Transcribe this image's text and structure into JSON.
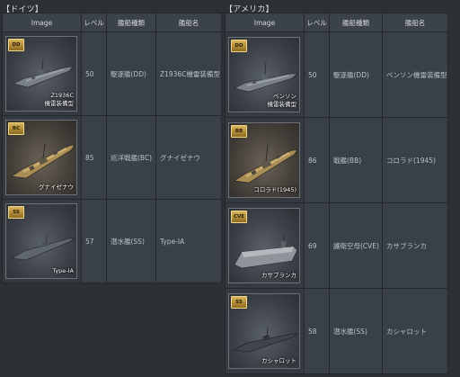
{
  "germany": {
    "title": "【ドイツ】",
    "headers": {
      "image": "Image",
      "level": "レベル",
      "type": "艦船種類",
      "name": "艦船名"
    },
    "rows": [
      {
        "badge": "DD",
        "caption1": "Z1936C",
        "caption2": "機雷装備型",
        "level": "50",
        "type": "駆逐艦(DD)",
        "name": "Z1936C機雷装備型",
        "icon": "destroyer-icon"
      },
      {
        "badge": "BC",
        "caption1": "グナイゼナウ",
        "caption2": "",
        "level": "85",
        "type": "巡洋戦艦(BC)",
        "name": "グナイゼナウ",
        "icon": "battlecruiser-icon"
      },
      {
        "badge": "SS",
        "caption1": "Type-IA",
        "caption2": "",
        "level": "57",
        "type": "潜水艦(SS)",
        "name": "Type-IA",
        "icon": "submarine-icon"
      }
    ]
  },
  "usa": {
    "title": "【アメリカ】",
    "headers": {
      "image": "Image",
      "level": "レベル",
      "type": "艦船種類",
      "name": "艦船名"
    },
    "rows": [
      {
        "badge": "DD",
        "caption1": "ベンソン",
        "caption2": "機雷装備型",
        "level": "50",
        "type": "駆逐艦(DD)",
        "name": "ベンソン機雷装備型",
        "icon": "destroyer-icon"
      },
      {
        "badge": "BB",
        "caption1": "コロラド(1945)",
        "caption2": "",
        "level": "86",
        "type": "戦艦(BB)",
        "name": "コロラド(1945)",
        "icon": "battleship-icon"
      },
      {
        "badge": "CVE",
        "caption1": "カサブランカ",
        "caption2": "",
        "level": "69",
        "type": "護衛空母(CVE)",
        "name": "カサブランカ",
        "icon": "escort-carrier-icon"
      },
      {
        "badge": "SS",
        "caption1": "カシャロット",
        "caption2": "",
        "level": "58",
        "type": "潜水艦(SS)",
        "name": "カシャロット",
        "icon": "submarine-icon"
      }
    ]
  }
}
